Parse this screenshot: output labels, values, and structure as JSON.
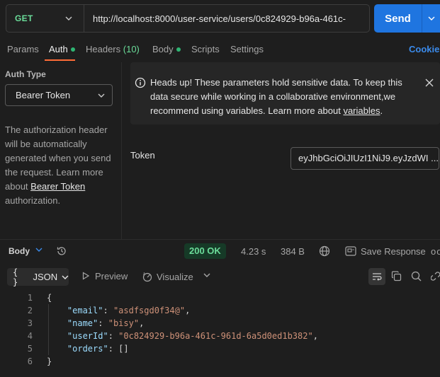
{
  "request": {
    "method": "GET",
    "url": "http://localhost:8000/user-service/users/0c824929-b96a-461c-",
    "send_label": "Send"
  },
  "request_tabs": {
    "params": "Params",
    "auth": "Auth",
    "headers": "Headers",
    "headers_count": "(10)",
    "body": "Body",
    "scripts": "Scripts",
    "settings": "Settings",
    "cookies": "Cookies"
  },
  "auth": {
    "type_label": "Auth Type",
    "type_value": "Bearer Token",
    "desc_part1": "The authorization header will be automatically generated when you send the request. Learn more about ",
    "desc_link": "Bearer Token",
    "desc_part2": " authorization.",
    "info_part1": "Heads up! These parameters hold sensitive data. To keep this data secure while working in a collaborative environment,we recommend using variables. Learn more about ",
    "info_link": "variables",
    "info_part2": ".",
    "token_label": "Token",
    "token_value": "eyJhbGciOiJIUzI1NiJ9.eyJzdWI ..."
  },
  "response": {
    "body_label": "Body",
    "status": "200 OK",
    "time": "4.23 s",
    "size": "384 B",
    "save_label": "Save Response",
    "more": "ooo",
    "format": "JSON",
    "format_braces": "{ }",
    "preview": "Preview",
    "visualize": "Visualize",
    "lines": [
      {
        "n": "1",
        "parts": [
          {
            "c": "p",
            "t": "{"
          }
        ]
      },
      {
        "n": "2",
        "parts": [
          {
            "c": "p",
            "t": "    "
          },
          {
            "c": "k",
            "t": "\"email\""
          },
          {
            "c": "p",
            "t": ": "
          },
          {
            "c": "s",
            "t": "\"asdfsgd0f34@\""
          },
          {
            "c": "p",
            "t": ","
          }
        ]
      },
      {
        "n": "3",
        "parts": [
          {
            "c": "p",
            "t": "    "
          },
          {
            "c": "k",
            "t": "\"name\""
          },
          {
            "c": "p",
            "t": ": "
          },
          {
            "c": "s",
            "t": "\"bisy\""
          },
          {
            "c": "p",
            "t": ","
          }
        ]
      },
      {
        "n": "4",
        "parts": [
          {
            "c": "p",
            "t": "    "
          },
          {
            "c": "k",
            "t": "\"userId\""
          },
          {
            "c": "p",
            "t": ": "
          },
          {
            "c": "s",
            "t": "\"0c824929-b96a-461c-961d-6a5d0ed1b382\""
          },
          {
            "c": "p",
            "t": ","
          }
        ]
      },
      {
        "n": "5",
        "parts": [
          {
            "c": "p",
            "t": "    "
          },
          {
            "c": "k",
            "t": "\"orders\""
          },
          {
            "c": "p",
            "t": ": []"
          }
        ]
      },
      {
        "n": "6",
        "parts": [
          {
            "c": "p",
            "t": "}"
          }
        ]
      }
    ]
  },
  "colors": {
    "method_get": "#6bdd9a",
    "send": "#1f75e0",
    "active_tab_underline": "#ff6c37",
    "status_ok": "#6bdd9a",
    "link": "#3b8beb"
  }
}
